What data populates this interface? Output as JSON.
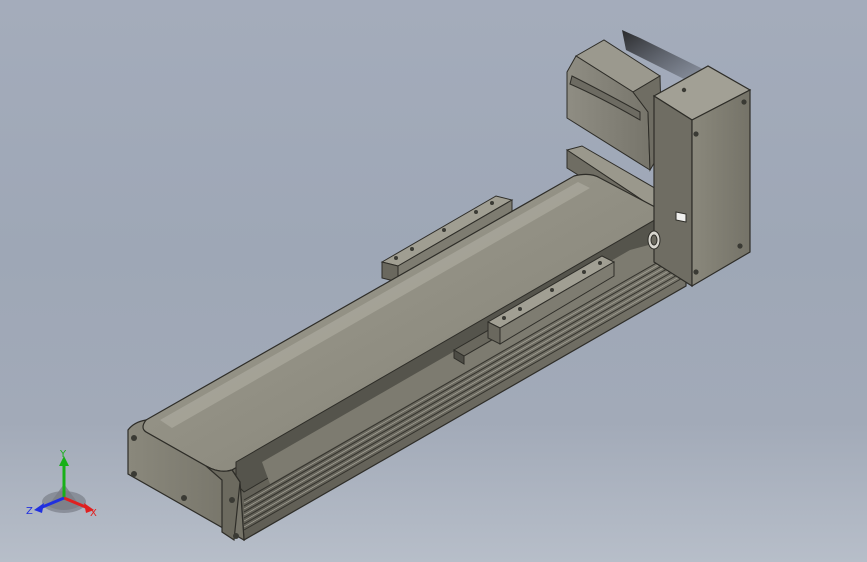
{
  "viewport": {
    "background_top": "#a4acbb",
    "background_bottom": "#b7bec9"
  },
  "model": {
    "body_color": "#8c8a7c",
    "body_light": "#9e9c8f",
    "body_dark": "#6c6a5f",
    "edge_color": "#2e2d28",
    "motor_color": "#85837a"
  },
  "triad": {
    "x_label": "X",
    "y_label": "Y",
    "z_label": "Z",
    "x_color": "#e02020",
    "y_color": "#18b018",
    "z_color": "#2030e0"
  }
}
